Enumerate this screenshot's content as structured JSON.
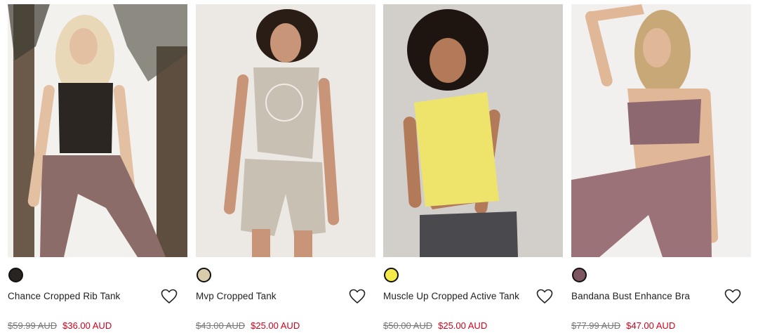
{
  "products": [
    {
      "name": "Chance Cropped Rib Tank",
      "old_price": "$59.99 AUD",
      "sale_price": "$36.00 AUD",
      "swatch_color": "#2a2420",
      "image_palette": {
        "bg": "#f3f1ee",
        "trunk": "#6b5a4a",
        "top": "#2b2622",
        "bottom": "#8c6c68",
        "skin": "#e3c0a2",
        "hair": "#e8d8b8"
      }
    },
    {
      "name": "Mvp Cropped Tank",
      "old_price": "$43.00 AUD",
      "sale_price": "$25.00 AUD",
      "swatch_color": "#d9ccab",
      "image_palette": {
        "bg": "#ece8e4",
        "top": "#c9c0b4",
        "bottom": "#c9c0b4",
        "skin": "#c89578",
        "hair": "#2a1d16"
      }
    },
    {
      "name": "Muscle Up Cropped Active Tank",
      "old_price": "$50.00 AUD",
      "sale_price": "$25.00 AUD",
      "swatch_color": "#f5ea4a",
      "image_palette": {
        "bg": "#d2cec9",
        "top": "#efe46b",
        "bottom": "#4a4a4e",
        "skin": "#b27a58",
        "hair": "#1e1410"
      }
    },
    {
      "name": "Bandana Bust Enhance Bra",
      "old_price": "$77.99 AUD",
      "sale_price": "$47.00 AUD",
      "swatch_color": "#7c5560",
      "image_palette": {
        "bg": "#f2f0ee",
        "top": "#8d6870",
        "bottom": "#9a7278",
        "skin": "#e0b898",
        "hair": "#c9a878"
      }
    }
  ]
}
